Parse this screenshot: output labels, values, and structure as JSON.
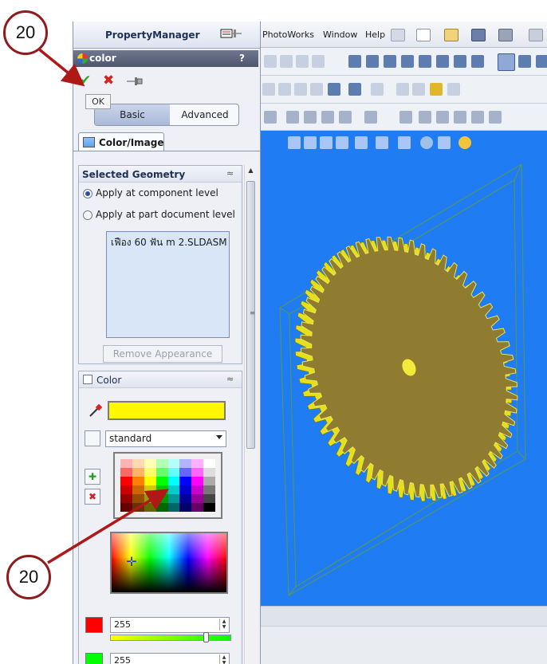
{
  "callouts": {
    "top": "20",
    "bottom": "20"
  },
  "property_manager": {
    "title": "PropertyManager",
    "feature": {
      "name": "color",
      "help": "?"
    },
    "tooltip": "OK",
    "tabs": {
      "basic": "Basic",
      "advanced": "Advanced"
    },
    "color_image_tab": "Color/Image"
  },
  "selected_geometry": {
    "title": "Selected Geometry",
    "options": [
      "Apply at component level",
      "Apply at part document level"
    ],
    "selected_index": 0,
    "list_items": [
      "เฟือง 60 ฟัน m 2.SLDASM"
    ],
    "remove_button": "Remove Appearance"
  },
  "color_group": {
    "title": "Color",
    "current_color": "#fff700",
    "palette_type": "standard",
    "rgb": [
      {
        "value": "255",
        "swatch": "#ff0000",
        "track_from": "#ffff00",
        "track_to": "#00ff00"
      },
      {
        "value": "255",
        "swatch": "#00ff00",
        "track_from": "#ff0000",
        "track_to": "#ffff00"
      }
    ]
  },
  "menubar": {
    "items": [
      "PhotoWorks",
      "Window",
      "Help"
    ]
  },
  "viewport": {
    "background": "#1f7cf2",
    "gear_color": "#e6e01a"
  },
  "icons": [
    "pushpin-icon",
    "ok-check-icon",
    "cancel-x-icon",
    "help-icon",
    "eyedropper-icon",
    "color-image-icon",
    "gear-model-icon"
  ]
}
